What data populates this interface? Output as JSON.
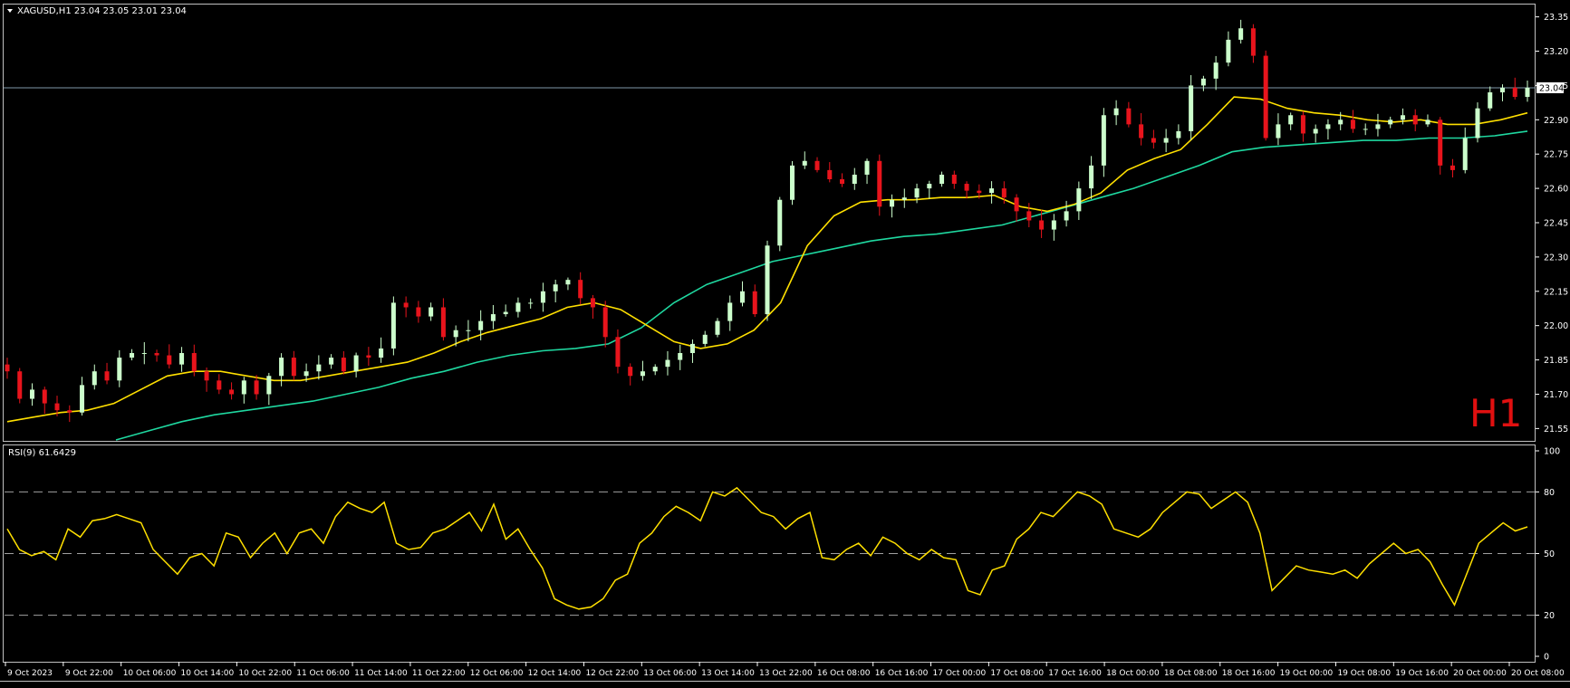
{
  "header": {
    "symbol_line": "XAGUSD,H1  23.04 23.05 23.01 23.04",
    "rsi_label": "RSI(9) 61.6429",
    "timeframe_badge": "H1"
  },
  "colors": {
    "background": "#000000",
    "bull_candle": "#ccffcc",
    "bear_candle": "#e8141c",
    "ma_fast": "#ffe000",
    "ma_slow": "#1fd8a0",
    "rsi_line": "#ffe000",
    "grid_dash": "#a0a0a0",
    "axis_text": "#ffffff",
    "price_line": "#7f98a8",
    "badge": "#e01010"
  },
  "chart_data": [
    {
      "type": "candlestick",
      "symbol": "XAGUSD",
      "timeframe": "H1",
      "ylim": [
        21.5,
        23.4
      ],
      "y_ticks": [
        "23.35",
        "23.20",
        "23.05",
        "22.90",
        "22.75",
        "22.60",
        "22.45",
        "22.30",
        "22.15",
        "22.00",
        "21.85",
        "21.70",
        "21.55"
      ],
      "current_price": "23.04",
      "x_ticks": [
        "9 Oct 2023",
        "9 Oct 22:00",
        "10 Oct 06:00",
        "10 Oct 14:00",
        "10 Oct 22:00",
        "11 Oct 06:00",
        "11 Oct 14:00",
        "11 Oct 22:00",
        "12 Oct 06:00",
        "12 Oct 14:00",
        "12 Oct 22:00",
        "13 Oct 06:00",
        "13 Oct 14:00",
        "13 Oct 22:00",
        "16 Oct 08:00",
        "16 Oct 16:00",
        "17 Oct 00:00",
        "17 Oct 08:00",
        "17 Oct 16:00",
        "18 Oct 00:00",
        "18 Oct 08:00",
        "18 Oct 16:00",
        "19 Oct 00:00",
        "19 Oct 08:00",
        "19 Oct 16:00",
        "20 Oct 00:00",
        "20 Oct 08:00"
      ],
      "close_path": [
        21.8,
        21.68,
        21.72,
        21.66,
        21.63,
        21.62,
        21.74,
        21.8,
        21.76,
        21.86,
        21.88,
        21.88,
        21.87,
        21.83,
        21.88,
        21.8,
        21.76,
        21.72,
        21.7,
        21.76,
        21.7,
        21.78,
        21.86,
        21.78,
        21.8,
        21.83,
        21.86,
        21.8,
        21.87,
        21.86,
        21.9,
        22.1,
        22.08,
        22.04,
        22.08,
        21.95,
        21.98,
        21.98,
        22.02,
        22.05,
        22.06,
        22.1,
        22.1,
        22.15,
        22.18,
        22.2,
        22.12,
        22.08,
        21.95,
        21.82,
        21.78,
        21.8,
        21.82,
        21.85,
        21.88,
        21.92,
        21.96,
        22.02,
        22.1,
        22.15,
        22.05,
        22.35,
        22.55,
        22.7,
        22.72,
        22.68,
        22.64,
        22.62,
        22.66,
        22.72,
        22.52,
        22.55,
        22.56,
        22.6,
        22.62,
        22.66,
        22.62,
        22.59,
        22.58,
        22.6,
        22.56,
        22.5,
        22.46,
        22.42,
        22.46,
        22.5,
        22.6,
        22.7,
        22.92,
        22.95,
        22.88,
        22.82,
        22.8,
        22.82,
        22.85,
        23.05,
        23.08,
        23.15,
        23.25,
        23.3,
        23.18,
        22.82,
        22.88,
        22.92,
        22.84,
        22.86,
        22.88,
        22.9,
        22.86,
        22.86,
        22.88,
        22.9,
        22.92,
        22.88,
        22.9,
        22.7,
        22.68,
        22.82,
        22.95,
        23.02,
        23.04,
        23.0,
        23.04
      ],
      "ma_fast_path": [
        21.58,
        21.6,
        21.62,
        21.63,
        21.66,
        21.72,
        21.78,
        21.8,
        21.8,
        21.78,
        21.76,
        21.76,
        21.78,
        21.8,
        21.82,
        21.84,
        21.88,
        21.93,
        21.97,
        22.0,
        22.03,
        22.08,
        22.1,
        22.07,
        22.0,
        21.93,
        21.9,
        21.92,
        21.98,
        22.1,
        22.35,
        22.48,
        22.54,
        22.55,
        22.55,
        22.56,
        22.56,
        22.57,
        22.52,
        22.5,
        22.53,
        22.58,
        22.68,
        22.73,
        22.77,
        22.88,
        23.0,
        22.99,
        22.95,
        22.93,
        22.92,
        22.9,
        22.89,
        22.9,
        22.88,
        22.88,
        22.9,
        22.93
      ],
      "ma_slow_path": [
        21.5,
        21.54,
        21.58,
        21.61,
        21.63,
        21.65,
        21.67,
        21.7,
        21.73,
        21.77,
        21.8,
        21.84,
        21.87,
        21.89,
        21.9,
        21.92,
        21.99,
        22.1,
        22.18,
        22.23,
        22.28,
        22.31,
        22.34,
        22.37,
        22.39,
        22.4,
        22.42,
        22.44,
        22.48,
        22.52,
        22.56,
        22.6,
        22.65,
        22.7,
        22.76,
        22.78,
        22.79,
        22.8,
        22.81,
        22.81,
        22.82,
        22.82,
        22.83,
        22.85
      ]
    },
    {
      "type": "line",
      "name": "RSI(9)",
      "ylim": [
        0,
        100
      ],
      "y_ticks": [
        100,
        80,
        50,
        20,
        0
      ],
      "levels": [
        80,
        50,
        20
      ],
      "values": [
        62,
        52,
        49,
        51,
        47,
        62,
        58,
        66,
        67,
        69,
        67,
        65,
        52,
        46,
        40,
        48,
        50,
        44,
        60,
        58,
        48,
        55,
        60,
        50,
        60,
        62,
        55,
        68,
        75,
        72,
        70,
        75,
        55,
        52,
        53,
        60,
        62,
        66,
        70,
        61,
        74,
        57,
        62,
        52,
        43,
        28,
        25,
        23,
        24,
        28,
        37,
        40,
        55,
        60,
        68,
        73,
        70,
        66,
        80,
        78,
        82,
        76,
        70,
        68,
        62,
        67,
        70,
        48,
        47,
        52,
        55,
        49,
        58,
        55,
        50,
        47,
        52,
        48,
        47,
        32,
        30,
        42,
        44,
        57,
        62,
        70,
        68,
        74,
        80,
        78,
        74,
        62,
        60,
        58,
        62,
        70,
        75,
        80,
        79,
        72,
        76,
        80,
        75,
        60,
        32,
        38,
        44,
        42,
        41,
        40,
        42,
        38,
        45,
        50,
        55,
        50,
        52,
        46,
        35,
        25,
        40,
        55,
        60,
        65,
        61,
        63
      ]
    }
  ]
}
